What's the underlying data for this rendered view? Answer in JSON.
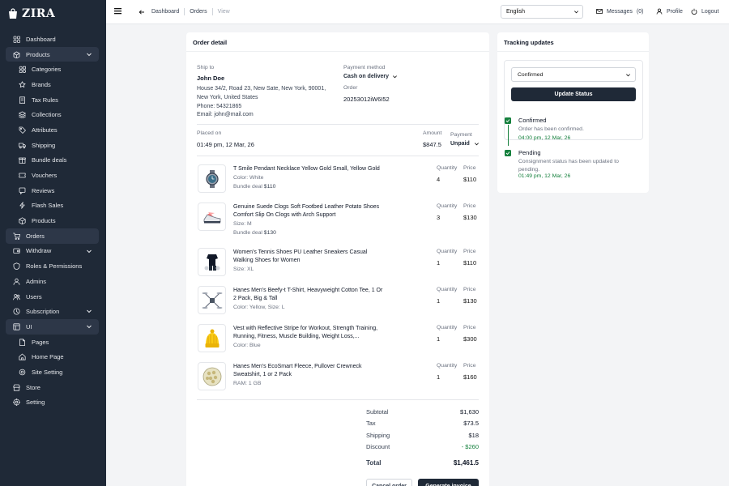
{
  "app": {
    "name": "ZIRA"
  },
  "sidebar": {
    "items": [
      {
        "label": "Dashboard",
        "icon": "grid-icon",
        "sub": false,
        "chevron": false,
        "active": false
      },
      {
        "label": "Products",
        "icon": "box-icon",
        "sub": false,
        "chevron": true,
        "active": true
      },
      {
        "label": "Categories",
        "icon": "category-icon",
        "sub": true,
        "chevron": false,
        "active": false
      },
      {
        "label": "Brands",
        "icon": "star-icon",
        "sub": true,
        "chevron": false,
        "active": false
      },
      {
        "label": "Tax Rules",
        "icon": "receipt-icon",
        "sub": true,
        "chevron": false,
        "active": false
      },
      {
        "label": "Collections",
        "icon": "layers-icon",
        "sub": true,
        "chevron": false,
        "active": false
      },
      {
        "label": "Attributes",
        "icon": "tag-icon",
        "sub": true,
        "chevron": false,
        "active": false
      },
      {
        "label": "Shipping",
        "icon": "truck-icon",
        "sub": true,
        "chevron": false,
        "active": false
      },
      {
        "label": "Bundle deals",
        "icon": "gift-icon",
        "sub": true,
        "chevron": false,
        "active": false
      },
      {
        "label": "Vouchers",
        "icon": "ticket-icon",
        "sub": true,
        "chevron": false,
        "active": false
      },
      {
        "label": "Reviews",
        "icon": "review-icon",
        "sub": true,
        "chevron": false,
        "active": false
      },
      {
        "label": "Flash Sales",
        "icon": "flash-icon",
        "sub": true,
        "chevron": false,
        "active": false
      },
      {
        "label": "Products",
        "icon": "cube-icon",
        "sub": true,
        "chevron": false,
        "active": false
      },
      {
        "label": "Orders",
        "icon": "cart-icon",
        "sub": false,
        "chevron": false,
        "active": true
      },
      {
        "label": "Withdraw",
        "icon": "wallet-icon",
        "sub": false,
        "chevron": true,
        "active": false
      },
      {
        "label": "Roles & Permissions",
        "icon": "shield-icon",
        "sub": false,
        "chevron": false,
        "active": false
      },
      {
        "label": "Admins",
        "icon": "user-shield-icon",
        "sub": false,
        "chevron": false,
        "active": false
      },
      {
        "label": "Users",
        "icon": "users-icon",
        "sub": false,
        "chevron": false,
        "active": false
      },
      {
        "label": "Subscription",
        "icon": "subscription-icon",
        "sub": false,
        "chevron": true,
        "active": false
      },
      {
        "label": "UI",
        "icon": "layout-icon",
        "sub": false,
        "chevron": true,
        "active": true
      },
      {
        "label": "Pages",
        "icon": "page-icon",
        "sub": true,
        "chevron": false,
        "active": false
      },
      {
        "label": "Home Page",
        "icon": "home-icon",
        "sub": true,
        "chevron": false,
        "active": false
      },
      {
        "label": "Site Setting",
        "icon": "cog-icon",
        "sub": true,
        "chevron": false,
        "active": false
      },
      {
        "label": "Store",
        "icon": "store-icon",
        "sub": false,
        "chevron": false,
        "active": false
      },
      {
        "label": "Setting",
        "icon": "settings-icon",
        "sub": false,
        "chevron": false,
        "active": false
      }
    ]
  },
  "topbar": {
    "breadcrumb": [
      "Dashboard",
      "Orders",
      "View"
    ],
    "language": "English",
    "messages_label": "Messages",
    "messages_count": "(0)",
    "profile_label": "Profile",
    "logout_label": "Logout"
  },
  "order": {
    "title": "Order detail",
    "ship_to_label": "Ship to",
    "customer_name": "John Doe",
    "address_line1": "House 34/2, Road 23, New Sate, New York, 90001,",
    "address_line2": "New York, United States",
    "phone": "Phone: 54321865",
    "email": "Email: john@mail.com",
    "payment_method_label": "Payment method",
    "payment_method": "Cash on delivery",
    "order_label": "Order",
    "order_id": "20253012iW6I52",
    "placed_on_label": "Placed on",
    "placed_on": "01:49 pm, 12 Mar, 26",
    "amount_label": "Amount",
    "amount": "$847.5",
    "payment_label": "Payment",
    "payment_status": "Unpaid",
    "quantity_label": "Quantity",
    "price_label": "Price",
    "items": [
      {
        "name1": "T Smile Pendant Necklace Yellow Gold Small, Yellow Gold",
        "name2": "",
        "meta": "Color: White",
        "bundle_label": "Bundle deal",
        "bundle": "$110",
        "qty": "4",
        "price": "$110",
        "thumb": "watch-icon"
      },
      {
        "name1": "Genuine Suede Clogs Soft Footbed Leather Potato Shoes",
        "name2": "Comfort Slip On Clogs with Arch Support",
        "meta": "Size: M",
        "bundle_label": "Bundle deal",
        "bundle": "$130",
        "qty": "3",
        "price": "$130",
        "thumb": "sneaker-icon"
      },
      {
        "name1": "Women's Tennis Shoes PU Leather Sneakers Casual",
        "name2": "Walking Shoes for Women",
        "meta": "Size: XL",
        "bundle_label": "",
        "bundle": "",
        "qty": "1",
        "price": "$110",
        "thumb": "outfit-icon"
      },
      {
        "name1": "Hanes Men's Beefy-t T-Shirt, Heavyweight Cotton Tee, 1 Or",
        "name2": "2 Pack, Big & Tall",
        "meta": "Color: Yellow, Size: L",
        "bundle_label": "",
        "bundle": "",
        "qty": "1",
        "price": "$130",
        "thumb": "drone-icon"
      },
      {
        "name1": "Vest with Reflective Stripe for Workout, Strength Training,",
        "name2": "Running, Fitness, Muscle Building, Weight Loss,...",
        "meta": "Color: Blue",
        "bundle_label": "",
        "bundle": "",
        "qty": "1",
        "price": "$300",
        "thumb": "beanie-icon"
      },
      {
        "name1": "Hanes Men's EcoSmart Fleece, Pullover Crewneck",
        "name2": "Sweatshirt, 1 or 2 Pack",
        "meta": "RAM: 1 GB",
        "bundle_label": "",
        "bundle": "",
        "qty": "1",
        "price": "$160",
        "thumb": "snack-icon"
      }
    ],
    "summary": {
      "subtotal_label": "Subtotal",
      "subtotal": "$1,630",
      "tax_label": "Tax",
      "tax": "$73.5",
      "shipping_label": "Shipping",
      "shipping": "$18",
      "discount_label": "Discount",
      "discount": "- $260",
      "total_label": "Total",
      "total": "$1,461.5"
    },
    "cancel_label": "Cancel order",
    "invoice_label": "Generate invoice"
  },
  "tracking": {
    "title": "Tracking updates",
    "status_select": "Confirmed",
    "update_button": "Update Status",
    "events": [
      {
        "title": "Confirmed",
        "desc1": "Order has been confirmed.",
        "desc2": "",
        "time": "04:00 pm, 12 Mar, 26"
      },
      {
        "title": "Pending",
        "desc1": "Consignment status has been updated to",
        "desc2": "pending.",
        "time": "01:49 pm, 12 Mar, 26"
      }
    ]
  },
  "colors": {
    "sidebar_bg": "#1f2937",
    "accent_dark": "#1f2937",
    "success": "#15803d"
  }
}
